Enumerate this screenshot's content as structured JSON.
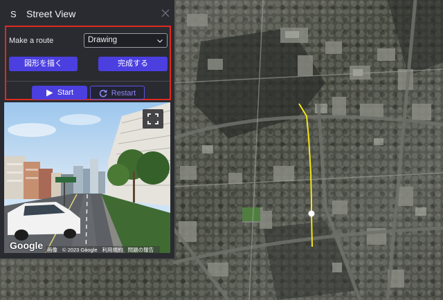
{
  "panel": {
    "logo_letter": "S",
    "title": "Street View",
    "route": {
      "label": "Make a route",
      "mode_selected": "Drawing",
      "draw_button": "図形を描く",
      "finish_button": "完成する"
    },
    "controls": {
      "start_button": "Start",
      "restart_button": "Restart"
    }
  },
  "street_view": {
    "logo": "Google",
    "footer": [
      "画像",
      "© 2023 Google",
      "利用規約",
      "問題の報告"
    ]
  },
  "colors": {
    "panel_bg": "#2a2b31",
    "accent": "#4b3fe0",
    "highlight_border": "#e02a1f",
    "route_line": "#f3e51a"
  },
  "icons": {
    "close": "close-icon",
    "dropdown": "chevron-down-icon",
    "start": "play-icon",
    "restart": "refresh-icon",
    "fullscreen": "fullscreen-icon"
  }
}
